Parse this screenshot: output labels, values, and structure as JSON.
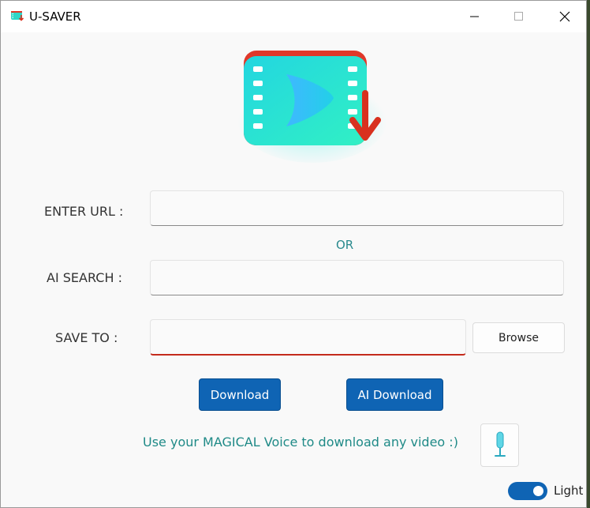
{
  "window": {
    "title": "U-SAVER"
  },
  "form": {
    "url_label": "ENTER URL :",
    "url_value": "",
    "or_text": "OR",
    "ai_label": "AI SEARCH :",
    "ai_value": "",
    "save_label": "SAVE TO :",
    "save_value": "",
    "browse_label": "Browse"
  },
  "actions": {
    "download_label": "Download",
    "ai_download_label": "AI Download"
  },
  "voice": {
    "text": "Use your MAGICAL Voice to download any video :)",
    "icon": "microphone-icon"
  },
  "theme": {
    "toggle_label": "Light",
    "toggle_on": true,
    "accent": "#0f64b4",
    "teal": "#1f8a87",
    "error": "#c42b1c"
  }
}
